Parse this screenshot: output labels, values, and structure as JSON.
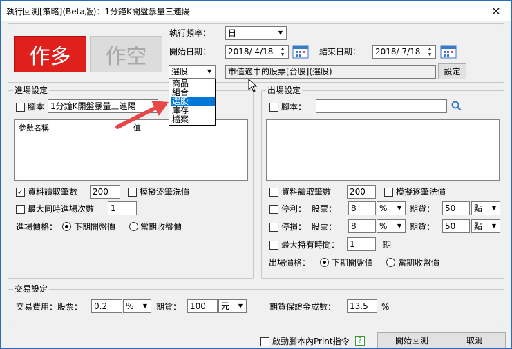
{
  "window": {
    "title": "執行回測[策略](Beta版)：1分鐘K開盤暴量三連陽",
    "close_glyph": "✕"
  },
  "header": {
    "buy_label": "作多",
    "sell_label": "作空",
    "freq_label": "執行頻率：",
    "freq_value": "日",
    "start_label": "開始日期：",
    "start_value": "2018/ 4/18",
    "end_label": "結束日期：",
    "end_value": "2018/ 7/18",
    "source_value": "選股",
    "source_options": [
      "商品",
      "組合",
      "選股",
      "庫存",
      "檔案"
    ],
    "source_selected_index": 2,
    "source_desc": "市值適中的股票[台股](選股)",
    "settings_label": "設定"
  },
  "entry": {
    "title": "進場設定",
    "script_label": "腳本",
    "script_value": "1分鐘K開盤暴量三連陽",
    "col_param": "參數名稱",
    "col_value": "值",
    "read_bars_label": "資料讀取筆數",
    "read_bars_value": "200",
    "simulate_label": "模擬逐筆洗價",
    "max_entries_label": "最大同時進場次數",
    "max_entries_value": "1",
    "price_label": "進場價格：",
    "price_opt1": "下期開盤價",
    "price_opt2": "當期收盤價"
  },
  "exit": {
    "title": "出場設定",
    "script_label": "腳本：",
    "script_value": "",
    "read_bars_label": "資料讀取筆數",
    "read_bars_value": "200",
    "simulate_label": "模擬逐筆洗價",
    "tp_label": "停利：",
    "sl_label": "停損：",
    "stock_label": "股票：",
    "future_label": "期貨：",
    "tp_stock_value": "8",
    "tp_stock_unit": "%",
    "tp_future_value": "50",
    "tp_future_unit": "點",
    "sl_stock_value": "8",
    "sl_stock_unit": "%",
    "sl_future_value": "50",
    "sl_future_unit": "點",
    "max_hold_label": "最大持有時間：",
    "max_hold_value": "1",
    "max_hold_unit": "期",
    "price_label": "出場價格：",
    "price_opt1": "下期開盤價",
    "price_opt2": "當期收盤價"
  },
  "trade": {
    "title": "交易設定",
    "fee_label": "交易費用：股票：",
    "fee_stock_value": "0.2",
    "fee_stock_unit": "%",
    "future_label": "期貨：",
    "fee_future_value": "100",
    "fee_future_unit": "元",
    "margin_label": "期貨保證金成數：",
    "margin_value": "13.5",
    "margin_unit": "%"
  },
  "footer": {
    "print_label": "啟動腳本內Print指令",
    "help_glyph": "?",
    "start_label": "開始回測",
    "cancel_label": "取消"
  },
  "colors": {
    "buy_red": "#e0201c",
    "accent_blue": "#0078d7",
    "arrow_red": "#e8474a"
  }
}
